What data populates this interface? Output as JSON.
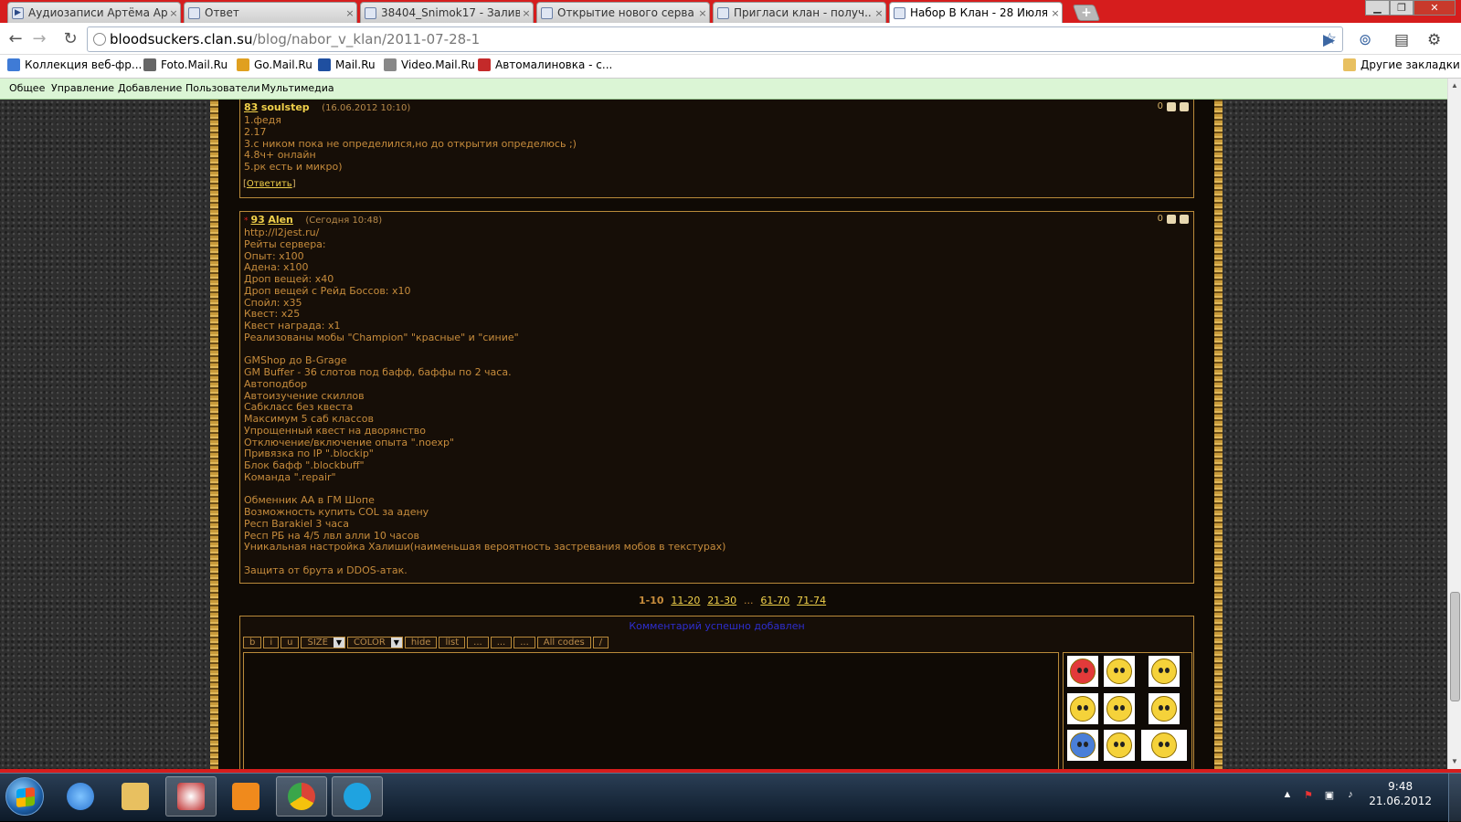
{
  "browser": {
    "tabs": [
      {
        "title": "Аудиозаписи Артёма Ар...",
        "active": false
      },
      {
        "title": "Ответ",
        "active": false
      },
      {
        "title": "38404_Snimok17 - Залив...",
        "active": false
      },
      {
        "title": "Открытие нового серва ...",
        "active": false
      },
      {
        "title": "Пригласи клан - получ...",
        "active": false
      },
      {
        "title": "Набор В Клан - 28 Июля...",
        "active": true
      }
    ],
    "close_glyph": "×",
    "new_tab_glyph": "+",
    "window_controls": {
      "minimize": "▁",
      "maximize": "❐",
      "close": "✕"
    },
    "url_host": "bloodsuckers.clan.su",
    "url_path": "/blog/nabor_v_klan/2011-07-28-1",
    "bookmarks": [
      {
        "label": "Коллекция веб-фр...",
        "color": "#3f7bd6"
      },
      {
        "label": "Foto.Mail.Ru",
        "color": "#666666"
      },
      {
        "label": "Go.Mail.Ru",
        "color": "#e0a020"
      },
      {
        "label": "Mail.Ru",
        "color": "#1f4fa0"
      },
      {
        "label": "Video.Mail.Ru",
        "color": "#888888"
      },
      {
        "label": "Автомалиновка - с...",
        "color": "#c42a2a"
      }
    ],
    "other_bookmarks": "Другие закладки"
  },
  "admin_bar": {
    "items": [
      "Общее",
      "Управление",
      "Добавление",
      "Пользователи",
      "Мультимедиа"
    ]
  },
  "comments": [
    {
      "number": "83",
      "author": "soulstep",
      "date": "(16.06.2012 10:10)",
      "rating": "0",
      "text": "1.федя\n2.17\n3.с ником пока не определился,но до открытия определюсь ;)\n4.8ч+ онлайн\n5.рк есть и микро)",
      "reply_label": "Ответить"
    },
    {
      "marker": "*",
      "number": "93",
      "author": "Alen",
      "date": "(Сегодня 10:48)",
      "rating": "0",
      "text": "http://l2jest.ru/\nРейты сервера:\nОпыт: x100\nАдена: x100\nДроп вещей: x40\nДроп вещей с Рейд Боссов: x10\nСпойл: x35\nКвест: x25\nКвест награда: x1\nРеализованы мобы \"Champion\" \"красные\" и \"синие\"\n\nGMShop до B-Grage\nGM Buffer - 36 слотов под бафф, баффы по 2 часа.\nАвтоподбор\nАвтоизучение скиллов\nСабкласс без квеста\nМаксимум 5 саб классов\nУпрощенный квест на дворянство\nОтключение/включение опыта \".noexp\"\nПривязка по IP \".blockip\"\nБлок бафф \".blockbuff\"\nКоманда \".repair\"\n\nОбменник АА в ГМ Шопе\nВозможность купить COL за адену\nРесп Barakiel 3 часа\nРесп РБ на 4/5 лвл алли 10 часов\nУникальная настройка Халиши(наименьшая вероятность застревания мобов в текстурах)\n\nЗащита от брута и DDOS-атак."
    }
  ],
  "pagination": {
    "current": "1-10",
    "pages": [
      "11-20",
      "21-30"
    ],
    "ellipsis": "...",
    "pages_after": [
      "61-70",
      "71-74"
    ]
  },
  "comment_form": {
    "success_message": "Комментарий успешно добавлен",
    "bb_buttons": [
      "b",
      "i",
      "u",
      "SIZE",
      "COLOR",
      "hide",
      "list",
      "...",
      "...",
      "...",
      "All codes",
      "/"
    ],
    "dropdown_glyph": "▼",
    "message_value": ""
  },
  "smileys": [
    {
      "name": "angry",
      "color": "#e23a3a"
    },
    {
      "name": "sad",
      "color": "#f5d23a"
    },
    {
      "name": "cool",
      "color": "#f5d23a"
    },
    {
      "name": "cry",
      "color": "#f5d23a"
    },
    {
      "name": "wink",
      "color": "#f5d23a"
    },
    {
      "name": "laugh",
      "color": "#f5d23a"
    },
    {
      "name": "cold",
      "color": "#4a7fd8"
    },
    {
      "name": "grin",
      "color": "#f5d23a"
    },
    {
      "name": "surprised",
      "color": "#f5d23a"
    }
  ],
  "taskbar": {
    "apps": [
      {
        "name": "internet-explorer",
        "open": false,
        "color": "#2a74d0"
      },
      {
        "name": "explorer",
        "open": false,
        "color": "#e8c060"
      },
      {
        "name": "paint",
        "open": true,
        "color": "#c03030"
      },
      {
        "name": "media-player",
        "open": false,
        "color": "#f08a1c"
      },
      {
        "name": "chrome",
        "open": true,
        "color": "#3aa64a"
      },
      {
        "name": "skype",
        "open": true,
        "color": "#1fa3e0"
      }
    ],
    "time": "9:48",
    "date": "21.06.2012"
  }
}
